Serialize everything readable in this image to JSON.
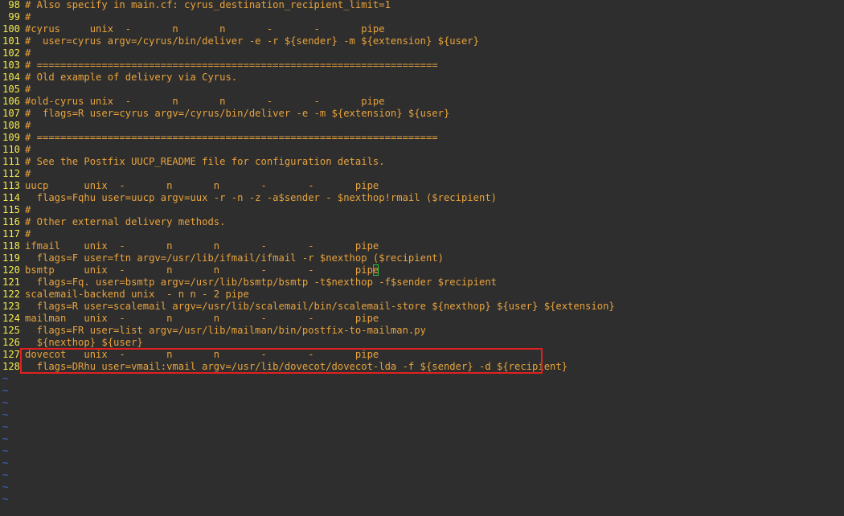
{
  "editor": {
    "lines": [
      {
        "n": "98",
        "t": "# Also specify in main.cf: cyrus_destination_recipient_limit=1"
      },
      {
        "n": "99",
        "t": "#"
      },
      {
        "n": "100",
        "t": "#cyrus     unix  -       n       n       -       -       pipe"
      },
      {
        "n": "101",
        "t": "#  user=cyrus argv=/cyrus/bin/deliver -e -r ${sender} -m ${extension} ${user}"
      },
      {
        "n": "102",
        "t": "#"
      },
      {
        "n": "103",
        "t": "# ===================================================================="
      },
      {
        "n": "104",
        "t": "# Old example of delivery via Cyrus."
      },
      {
        "n": "105",
        "t": "#"
      },
      {
        "n": "106",
        "t": "#old-cyrus unix  -       n       n       -       -       pipe"
      },
      {
        "n": "107",
        "t": "#  flags=R user=cyrus argv=/cyrus/bin/deliver -e -m ${extension} ${user}"
      },
      {
        "n": "108",
        "t": "#"
      },
      {
        "n": "109",
        "t": "# ===================================================================="
      },
      {
        "n": "110",
        "t": "#"
      },
      {
        "n": "111",
        "t": "# See the Postfix UUCP_README file for configuration details."
      },
      {
        "n": "112",
        "t": "#"
      },
      {
        "n": "113",
        "t": "uucp      unix  -       n       n       -       -       pipe"
      },
      {
        "n": "114",
        "t": "  flags=Fqhu user=uucp argv=uux -r -n -z -a$sender - $nexthop!rmail ($recipient)"
      },
      {
        "n": "115",
        "t": "#"
      },
      {
        "n": "116",
        "t": "# Other external delivery methods."
      },
      {
        "n": "117",
        "t": "#"
      },
      {
        "n": "118",
        "t": "ifmail    unix  -       n       n       -       -       pipe"
      },
      {
        "n": "119",
        "t": "  flags=F user=ftn argv=/usr/lib/ifmail/ifmail -r $nexthop ($recipient)"
      },
      {
        "n": "120",
        "t": "bsmtp     unix  -       n       n       -       -       pipe"
      },
      {
        "n": "121",
        "t": "  flags=Fq. user=bsmtp argv=/usr/lib/bsmtp/bsmtp -t$nexthop -f$sender $recipient"
      },
      {
        "n": "122",
        "t": "scalemail-backend unix  - n n - 2 pipe"
      },
      {
        "n": "123",
        "t": "  flags=R user=scalemail argv=/usr/lib/scalemail/bin/scalemail-store ${nexthop} ${user} ${extension}"
      },
      {
        "n": "124",
        "t": "mailman   unix  -       n       n       -       -       pipe"
      },
      {
        "n": "125",
        "t": "  flags=FR user=list argv=/usr/lib/mailman/bin/postfix-to-mailman.py"
      },
      {
        "n": "126",
        "t": "  ${nexthop} ${user}"
      },
      {
        "n": "127",
        "t": "dovecot   unix  -       n       n       -       -       pipe"
      },
      {
        "n": "128",
        "t": "  flags=DRhu user=vmail:vmail argv=/usr/lib/dovecot/dovecot-lda -f ${sender} -d ${recipient}"
      }
    ],
    "tilde_char": "~",
    "colors": {
      "background": "#2e2e2e",
      "text": "#e8a33c",
      "line_number": "#f2e94e",
      "tilde": "#3a6cc8",
      "cursor": "#2ec63a",
      "highlight_box": "#e02020"
    }
  }
}
